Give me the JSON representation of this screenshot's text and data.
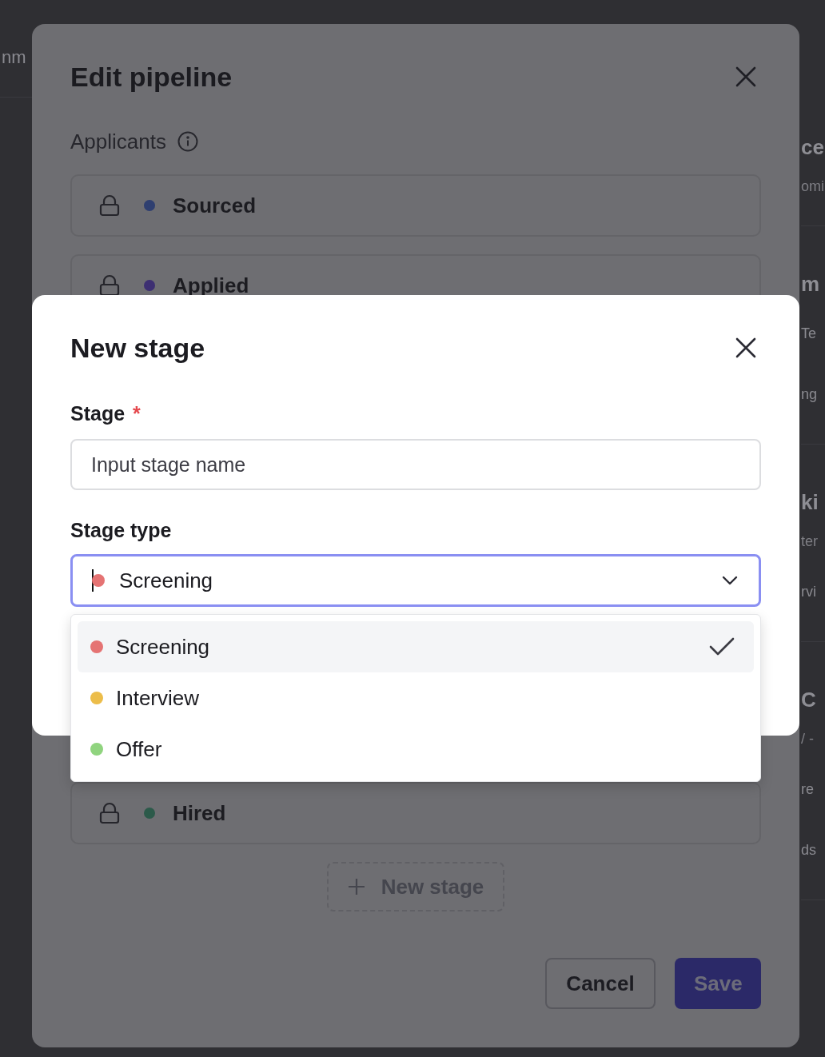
{
  "background_page": {
    "left_fragment": "nm",
    "right_sections": [
      {
        "title": "ce",
        "lines": [
          {
            "kind": "subtitle",
            "text": "omi"
          }
        ]
      },
      {
        "title": "m",
        "lines": [
          {
            "kind": "item",
            "text": "Te"
          },
          {
            "kind": "item",
            "text": "ng"
          }
        ]
      },
      {
        "title": "ki",
        "lines": [
          {
            "kind": "subtitle",
            "text": "ter"
          },
          {
            "kind": "item",
            "text": "rvi"
          }
        ]
      },
      {
        "title": "C",
        "lines": [
          {
            "kind": "subtitle",
            "text": "/ -"
          },
          {
            "kind": "item",
            "text": "re"
          },
          {
            "kind": "item",
            "text": "ds"
          }
        ]
      }
    ]
  },
  "edit_pipeline": {
    "title": "Edit pipeline",
    "section_label": "Applicants",
    "stages": [
      {
        "name": "Sourced",
        "color": "#2f3f70"
      },
      {
        "name": "Applied",
        "color": "#3d2f72"
      },
      {
        "name": "Hired",
        "color": "#2c5a4a"
      }
    ],
    "new_stage_button": "New stage",
    "buttons": [
      {
        "label": "Cancel",
        "kind": "secondary"
      },
      {
        "label": "Save",
        "kind": "primary"
      }
    ]
  },
  "new_stage_dialog": {
    "title": "New stage",
    "stage_field": {
      "label": "Stage",
      "required_mark": "*",
      "placeholder": "Input stage name"
    },
    "stage_type_field": {
      "label": "Stage type",
      "value": "Screening",
      "color": "#e57373",
      "focused": true
    },
    "options": [
      {
        "label": "Screening",
        "color": "#e57373",
        "selected": true
      },
      {
        "label": "Interview",
        "color": "#ecbd4a",
        "selected": false
      },
      {
        "label": "Offer",
        "color": "#90d47f",
        "selected": false
      }
    ]
  }
}
